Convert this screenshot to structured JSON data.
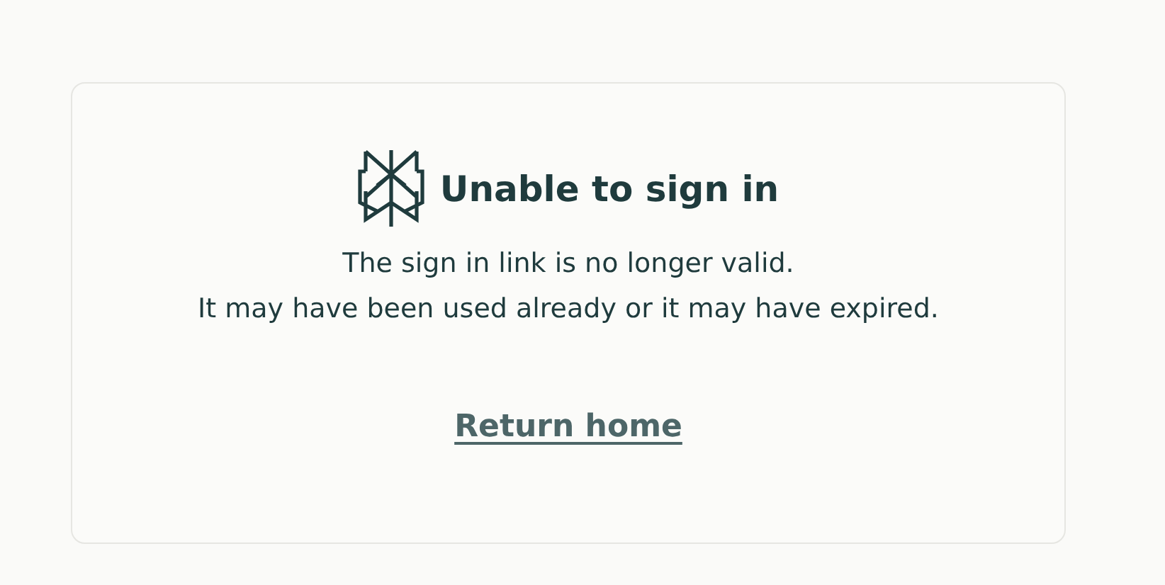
{
  "card": {
    "title": "Unable to sign in",
    "message_lines": [
      "The sign in link is no longer valid.",
      "It may have been used already or it may have expired."
    ],
    "link": "Return home"
  }
}
